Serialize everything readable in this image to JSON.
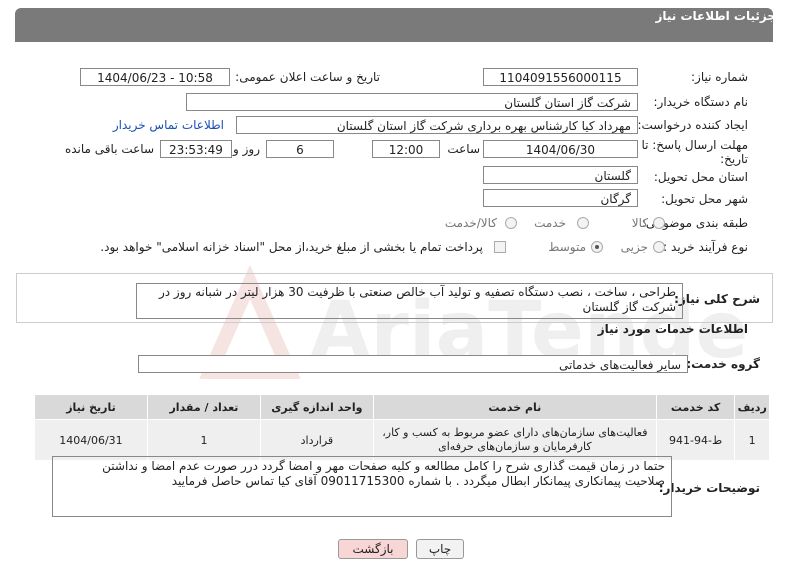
{
  "header": {
    "title": "جزئیات اطلاعات نیاز"
  },
  "fields": {
    "need_number_label": "شماره نیاز:",
    "need_number": "1104091556000115",
    "announce_label": "تاریخ و ساعت اعلان عمومی:",
    "announce_value": "1404/06/23 - 10:58",
    "buyer_org_label": "نام دستگاه خریدار:",
    "buyer_org": "شرکت گاز استان گلستان",
    "creator_label": "ایجاد کننده درخواست:",
    "creator": "مهرداد کیا کارشناس بهره برداری شرکت گاز استان گلستان",
    "contact_link": "اطلاعات تماس خریدار",
    "deadline_label_1": "مهلت ارسال پاسخ: تا",
    "deadline_label_2": "تاریخ:",
    "deadline_date": "1404/06/30",
    "time_label": "ساعت",
    "deadline_time": "12:00",
    "days_value": "6",
    "days_label": "روز و",
    "remaining_time": "23:53:49",
    "remaining_label": "ساعت باقی مانده",
    "province_label": "استان محل تحویل:",
    "province": "گلستان",
    "city_label": "شهر محل تحویل:",
    "city": "گرگان",
    "category_label": "طبقه بندی موضوعی:",
    "category_options": [
      "کالا",
      "خدمت",
      "کالا/خدمت"
    ],
    "category_selected": "خدمت",
    "process_label": "نوع فرآیند خرید :",
    "process_options": [
      "جزیی",
      "متوسط"
    ],
    "process_selected": "متوسط",
    "payment_note": "پرداخت تمام یا بخشی از مبلغ خرید،از محل \"اسناد خزانه اسلامی\" خواهد بود."
  },
  "summary": {
    "label": "شرح کلی نیاز:",
    "text": "طراحی ، ساخت ، نصب دستگاه تصفیه و تولید آب خالص صنعتی با ظرفیت 30 هزار لیتر در شبانه روز در شرکت گاز گلستان"
  },
  "services": {
    "section_title": "اطلاعات خدمات مورد نیاز",
    "group_label": "گروه خدمت:",
    "group_value": "سایر فعالیت‌های خدماتی",
    "columns": [
      "ردیف",
      "کد خدمت",
      "نام خدمت",
      "واحد اندازه گیری",
      "تعداد / مقدار",
      "تاریخ نیاز"
    ],
    "rows": [
      {
        "index": "1",
        "code": "ط-94-941",
        "name": "فعالیت‌های سازمان‌های دارای عضو مربوط به کسب و کار، کارفرمایان و سازمان‌های حرفه‌ای",
        "unit": "قرارداد",
        "qty": "1",
        "date": "1404/06/31"
      }
    ]
  },
  "buyer_notes": {
    "label": "توضیحات خریدار:",
    "text": "حتما در زمان قیمت گذاری شرح را کامل مطالعه و کلیه صفحات مهر و امضا گردد درر صورت عدم امضا و نداشتن صلاحیت پیمانکاری  پیمانکار ابطال میگردد  . با شماره 09011715300 آقای کیا تماس حاصل فرمایید"
  },
  "buttons": {
    "print": "چاپ",
    "back": "بازگشت"
  },
  "watermark": {
    "text": "AriaTender.neT"
  },
  "colors": {
    "header_bg": "#7a7a7a",
    "link": "#1a4fb8",
    "back_btn_bg": "#f9d6d6",
    "watermark": "#c0392b"
  }
}
